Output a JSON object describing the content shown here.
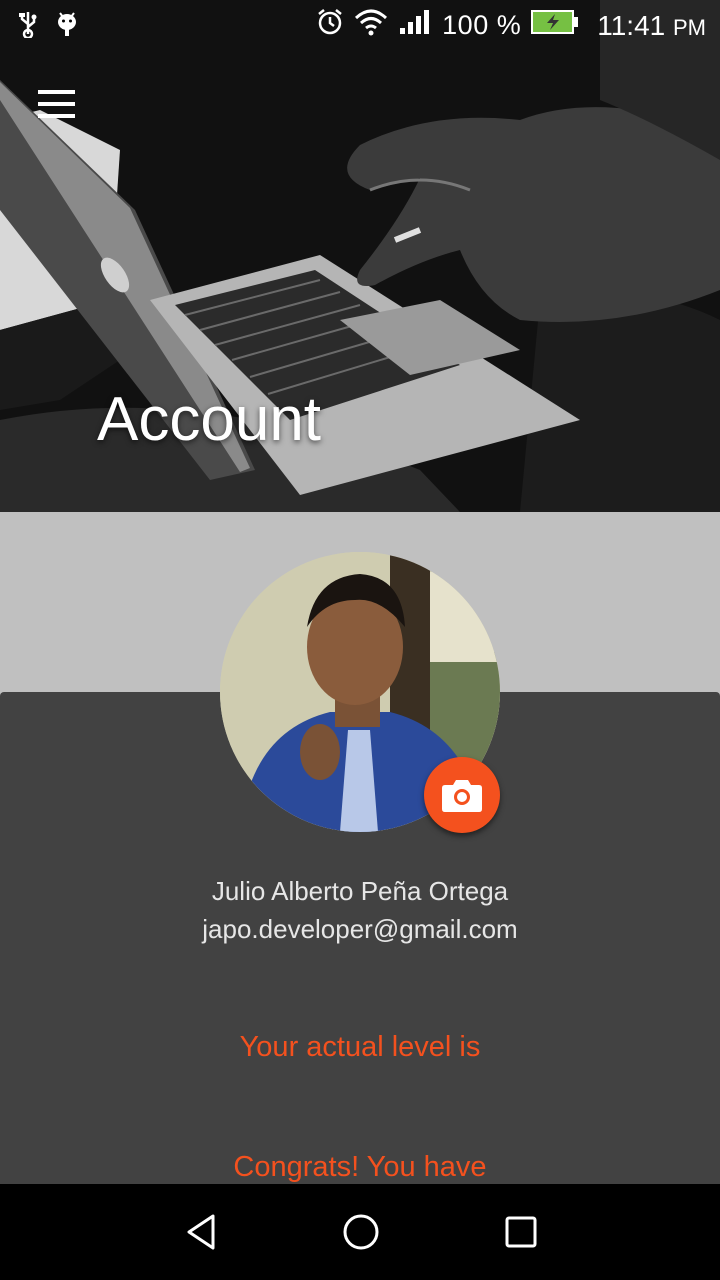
{
  "status_bar": {
    "left_icons": [
      "usb-icon",
      "android-debug-icon"
    ],
    "alarm_icon": "alarm-icon",
    "wifi_icon": "wifi-icon",
    "signal_icon": "signal-icon",
    "battery_percent": "100 %",
    "battery_icon": "battery-charging-icon",
    "time": "11:41",
    "ampm": "PM"
  },
  "header": {
    "title": "Account",
    "menu_icon": "hamburger-menu-icon"
  },
  "profile": {
    "name": "Julio Alberto Peña Ortega",
    "email": "japo.developer@gmail.com",
    "camera_icon": "camera-icon"
  },
  "content": {
    "level_text": "Your actual level is",
    "congrats_text": "Congrats! You have"
  },
  "nav_bar": {
    "back_icon": "back-triangle-icon",
    "home_icon": "home-circle-icon",
    "recents_icon": "recents-square-icon"
  },
  "colors": {
    "accent": "#f4511e",
    "panel": "#424242",
    "background": "#c0c0c0"
  }
}
